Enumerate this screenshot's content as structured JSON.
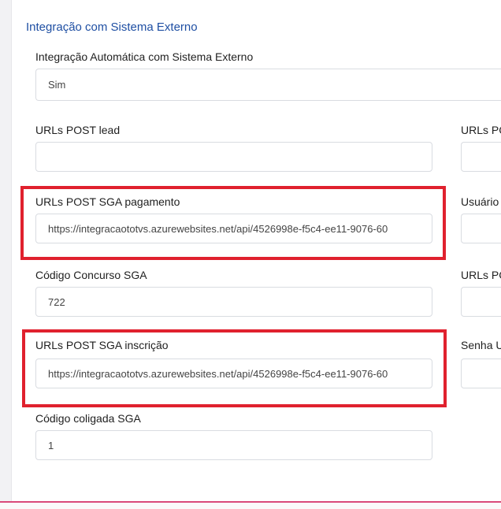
{
  "section": {
    "title": "Integração com Sistema Externo"
  },
  "fields": {
    "auto_integration": {
      "label": "Integração Automática com Sistema Externo",
      "value": "Sim"
    },
    "post_lead": {
      "label": "URLs POST lead",
      "value": ""
    },
    "post_sga_pagamento": {
      "label": "URLs POST SGA pagamento",
      "value": "https://integracaototvs.azurewebsites.net/api/4526998e-f5c4-ee11-9076-60"
    },
    "codigo_concurso": {
      "label": "Código Concurso SGA",
      "value": "722"
    },
    "post_sga_inscricao": {
      "label": "URLs POST SGA inscrição",
      "value": "https://integracaototvs.azurewebsites.net/api/4526998e-f5c4-ee11-9076-60"
    },
    "codigo_coligada": {
      "label": "Código coligada SGA",
      "value": "1"
    }
  },
  "right_column": {
    "label_1": "URLs PC",
    "label_2": "Usuário",
    "label_3": "URLs PC",
    "label_4": "Senha U",
    "value_1": "",
    "value_2": "",
    "value_3": "",
    "value_4": ""
  },
  "highlight_color": "#e0212e"
}
